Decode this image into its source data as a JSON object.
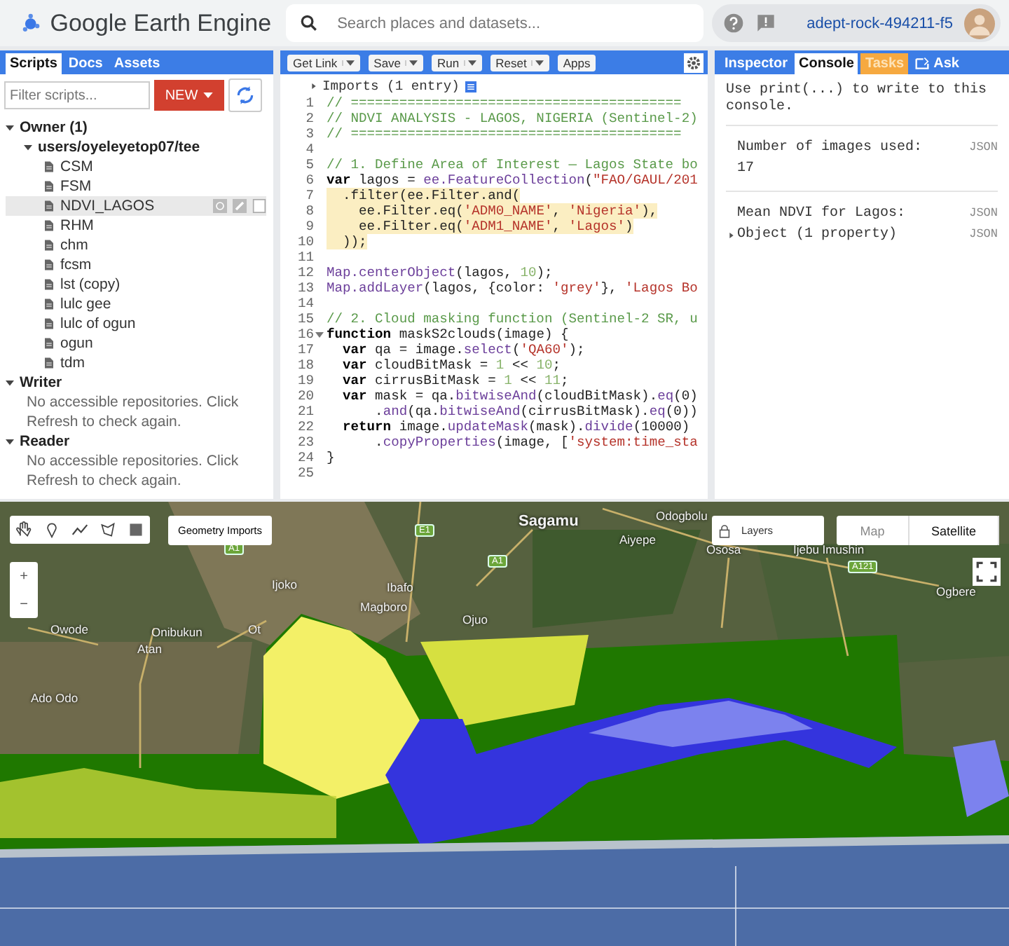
{
  "app": {
    "title": "Google Earth Engine"
  },
  "search": {
    "placeholder": "Search places and datasets..."
  },
  "project": "adept-rock-494211-f5",
  "left_panel": {
    "tabs": [
      {
        "label": "Scripts",
        "selected": true
      },
      {
        "label": "Docs",
        "selected": false
      },
      {
        "label": "Assets",
        "selected": false
      }
    ],
    "filter": {
      "placeholder": "Filter scripts..."
    },
    "new_button": "NEW",
    "tree": [
      {
        "label": "Owner (1)",
        "expanded": true,
        "children": [
          {
            "label": "users/oyeleyetop07/tee",
            "expanded": true,
            "children": [
              {
                "label": "CSM",
                "selected": false
              },
              {
                "label": "FSM",
                "selected": false
              },
              {
                "label": "NDVI_LAGOS",
                "selected": true
              },
              {
                "label": "RHM",
                "selected": false
              },
              {
                "label": "chm",
                "selected": false
              },
              {
                "label": "fcsm",
                "selected": false
              },
              {
                "label": "lst (copy)",
                "selected": false
              },
              {
                "label": "lulc gee",
                "selected": false
              },
              {
                "label": "lulc of ogun",
                "selected": false
              },
              {
                "label": "ogun",
                "selected": false
              },
              {
                "label": "tdm",
                "selected": false
              }
            ]
          }
        ]
      },
      {
        "label": "Writer",
        "expanded": true,
        "message": "No accessible repositories. Click Refresh to check again."
      },
      {
        "label": "Reader",
        "expanded": true,
        "message": "No accessible repositories. Click Refresh to check again."
      }
    ]
  },
  "editor": {
    "toolbar": [
      {
        "label": "Get Link",
        "dropdown": true
      },
      {
        "label": "Save",
        "dropdown": true
      },
      {
        "label": "Run",
        "dropdown": true
      },
      {
        "label": "Reset",
        "dropdown": true
      },
      {
        "label": "Apps",
        "dropdown": false
      }
    ],
    "imports": "Imports (1 entry)",
    "lines": [
      {
        "n": "1",
        "tokens": [
          {
            "kind": "comment",
            "text": "// ========================================="
          }
        ]
      },
      {
        "n": "2",
        "tokens": [
          {
            "kind": "comment",
            "text": "// NDVI ANALYSIS - LAGOS, NIGERIA (Sentinel-2)"
          }
        ]
      },
      {
        "n": "3",
        "tokens": [
          {
            "kind": "comment",
            "text": "// ========================================="
          }
        ]
      },
      {
        "n": "4"
      },
      {
        "n": "5",
        "tokens": [
          {
            "kind": "comment",
            "text": "// 1. Define Area of Interest — Lagos State bo"
          }
        ]
      },
      {
        "n": "6",
        "tokens": [
          {
            "kind": "keyword",
            "text": "var"
          },
          {
            "kind": "plain",
            "text": " lagos = "
          },
          {
            "kind": "api",
            "text": "ee.FeatureCollection"
          },
          {
            "kind": "plain",
            "text": "("
          },
          {
            "kind": "string",
            "text": "\"FAO/GAUL/201"
          }
        ]
      },
      {
        "n": "7",
        "highlighted": true,
        "tokens": [
          {
            "kind": "plain",
            "text": "  .filter(ee.Filter.and("
          }
        ]
      },
      {
        "n": "8",
        "highlighted": true,
        "tokens": [
          {
            "kind": "plain",
            "text": "    ee.Filter.eq("
          },
          {
            "kind": "string",
            "text": "'ADM0_NAME'"
          },
          {
            "kind": "plain",
            "text": ", "
          },
          {
            "kind": "string",
            "text": "'Nigeria'"
          },
          {
            "kind": "plain",
            "text": "),"
          }
        ]
      },
      {
        "n": "9",
        "highlighted": true,
        "tokens": [
          {
            "kind": "plain",
            "text": "    ee.Filter.eq("
          },
          {
            "kind": "string",
            "text": "'ADM1_NAME'"
          },
          {
            "kind": "plain",
            "text": ", "
          },
          {
            "kind": "string",
            "text": "'Lagos'"
          },
          {
            "kind": "plain",
            "text": ")"
          }
        ]
      },
      {
        "n": "10",
        "highlighted": true,
        "tokens": [
          {
            "kind": "plain",
            "text": "  ));"
          }
        ]
      },
      {
        "n": "11"
      },
      {
        "n": "12",
        "tokens": [
          {
            "kind": "api",
            "text": "Map.centerObject"
          },
          {
            "kind": "plain",
            "text": "(lagos, "
          },
          {
            "kind": "number",
            "text": "10"
          },
          {
            "kind": "plain",
            "text": ");"
          }
        ]
      },
      {
        "n": "13",
        "tokens": [
          {
            "kind": "api",
            "text": "Map.addLayer"
          },
          {
            "kind": "plain",
            "text": "(lagos, {color: "
          },
          {
            "kind": "string",
            "text": "'grey'"
          },
          {
            "kind": "plain",
            "text": "}, "
          },
          {
            "kind": "string",
            "text": "'Lagos Bo"
          }
        ]
      },
      {
        "n": "14"
      },
      {
        "n": "15",
        "tokens": [
          {
            "kind": "comment",
            "text": "// 2. Cloud masking function (Sentinel-2 SR, u"
          }
        ]
      },
      {
        "n": "16",
        "fold": true,
        "tokens": [
          {
            "kind": "keyword",
            "text": "function"
          },
          {
            "kind": "plain",
            "text": " maskS2clouds(image) {"
          }
        ]
      },
      {
        "n": "17",
        "tokens": [
          {
            "kind": "keyword",
            "text": "  var"
          },
          {
            "kind": "plain",
            "text": " qa = image."
          },
          {
            "kind": "api",
            "text": "select"
          },
          {
            "kind": "plain",
            "text": "("
          },
          {
            "kind": "string",
            "text": "'QA60'"
          },
          {
            "kind": "plain",
            "text": ");"
          }
        ]
      },
      {
        "n": "18",
        "tokens": [
          {
            "kind": "keyword",
            "text": "  var"
          },
          {
            "kind": "plain",
            "text": " cloudBitMask = "
          },
          {
            "kind": "number",
            "text": "1"
          },
          {
            "kind": "plain",
            "text": " << "
          },
          {
            "kind": "number",
            "text": "10"
          },
          {
            "kind": "plain",
            "text": ";"
          }
        ]
      },
      {
        "n": "19",
        "tokens": [
          {
            "kind": "keyword",
            "text": "  var"
          },
          {
            "kind": "plain",
            "text": " cirrusBitMask = "
          },
          {
            "kind": "number",
            "text": "1"
          },
          {
            "kind": "plain",
            "text": " << "
          },
          {
            "kind": "number",
            "text": "11"
          },
          {
            "kind": "plain",
            "text": ";"
          }
        ]
      },
      {
        "n": "20",
        "tokens": [
          {
            "kind": "keyword",
            "text": "  var"
          },
          {
            "kind": "plain",
            "text": " mask = qa."
          },
          {
            "kind": "api",
            "text": "bitwiseAnd"
          },
          {
            "kind": "plain",
            "text": "(cloudBitMask)."
          },
          {
            "kind": "api",
            "text": "eq"
          },
          {
            "kind": "plain",
            "text": "(0)"
          }
        ]
      },
      {
        "n": "21",
        "tokens": [
          {
            "kind": "plain",
            "text": "      ."
          },
          {
            "kind": "api",
            "text": "and"
          },
          {
            "kind": "plain",
            "text": "(qa."
          },
          {
            "kind": "api",
            "text": "bitwiseAnd"
          },
          {
            "kind": "plain",
            "text": "(cirrusBitMask)."
          },
          {
            "kind": "api",
            "text": "eq"
          },
          {
            "kind": "plain",
            "text": "(0))"
          }
        ]
      },
      {
        "n": "22",
        "tokens": [
          {
            "kind": "keyword",
            "text": "  return"
          },
          {
            "kind": "plain",
            "text": " image."
          },
          {
            "kind": "api",
            "text": "updateMask"
          },
          {
            "kind": "plain",
            "text": "(mask)."
          },
          {
            "kind": "api",
            "text": "divide"
          },
          {
            "kind": "plain",
            "text": "(10000)"
          }
        ]
      },
      {
        "n": "23",
        "tokens": [
          {
            "kind": "plain",
            "text": "      ."
          },
          {
            "kind": "api",
            "text": "copyProperties"
          },
          {
            "kind": "plain",
            "text": "(image, ["
          },
          {
            "kind": "string",
            "text": "'system:time_sta"
          }
        ]
      },
      {
        "n": "24",
        "tokens": [
          {
            "kind": "plain",
            "text": "}"
          }
        ]
      },
      {
        "n": "25"
      }
    ]
  },
  "right_panel": {
    "tabs": [
      {
        "label": "Inspector",
        "selected": false,
        "attention": false,
        "icon": false
      },
      {
        "label": "Console",
        "selected": true,
        "attention": false,
        "icon": false
      },
      {
        "label": "Tasks",
        "selected": false,
        "attention": true,
        "icon": false
      },
      {
        "label": "Ask",
        "selected": false,
        "attention": false,
        "icon": true
      }
    ],
    "hint": "Use print(...) to write to this console.",
    "entries": [
      {
        "rows": [
          {
            "text": "Number of images used:",
            "json": "JSON"
          },
          {
            "text": "17"
          }
        ]
      },
      {
        "rows": [
          {
            "text": "Mean NDVI for Lagos:",
            "json": "JSON"
          },
          {
            "text": "Object (1 property)",
            "json": "JSON",
            "expanded": false
          }
        ]
      }
    ]
  },
  "map": {
    "tools": [
      {
        "kind": "hand"
      },
      {
        "kind": "pin"
      },
      {
        "kind": "line"
      },
      {
        "kind": "polygon"
      },
      {
        "kind": "rectangle"
      }
    ],
    "geometry_imports": "Geometry Imports",
    "zoom": [
      "+",
      "−"
    ],
    "layers": "Layers",
    "map_types": [
      {
        "label": "Map",
        "selected": false
      },
      {
        "label": "Satellite",
        "selected": true
      }
    ],
    "places": [
      {
        "name": "Sagamu",
        "major": true
      },
      {
        "name": "Odogbolu",
        "major": false
      },
      {
        "name": "Aiyepe",
        "major": false
      },
      {
        "name": "Ososa",
        "major": false
      },
      {
        "name": "Ijebu Imushin",
        "major": false
      },
      {
        "name": "Ogbere",
        "major": false
      },
      {
        "name": "Ijoko",
        "major": false
      },
      {
        "name": "Ibafo",
        "major": false
      },
      {
        "name": "Magboro",
        "major": false
      },
      {
        "name": "Ojuo",
        "major": false
      },
      {
        "name": "Owode",
        "major": false
      },
      {
        "name": "Onibukun",
        "major": false
      },
      {
        "name": "Ot",
        "major": false
      },
      {
        "name": "Atan",
        "major": false
      },
      {
        "name": "Ado Odo",
        "major": false
      }
    ],
    "road_shields": [
      "E1",
      "A1",
      "A1",
      "A121"
    ]
  }
}
